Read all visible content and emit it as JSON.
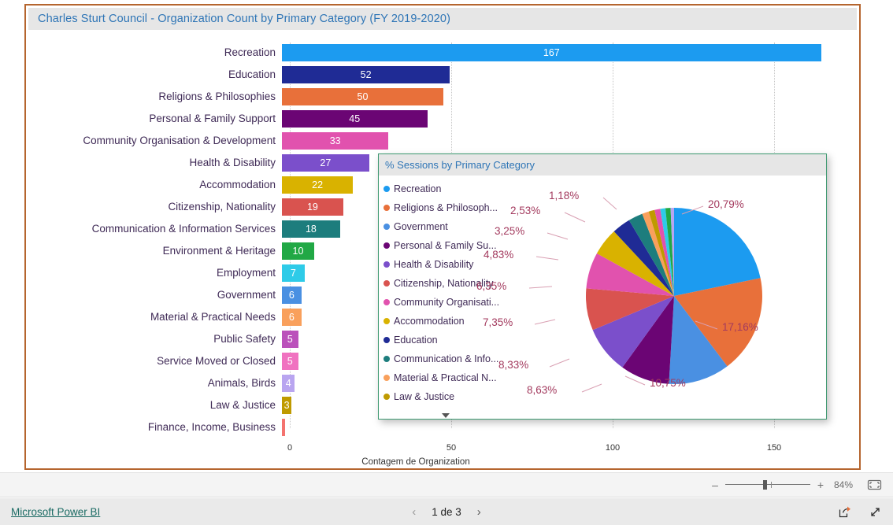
{
  "report": {
    "bar_visual_title": "Charles Sturt Council - Organization Count by Primary Category (FY 2019-2020)",
    "pie_visual_title": "% Sessions by Primary Category",
    "axis_title": "Contagem de Organization",
    "accent_border": "#b5652e",
    "title_color": "#2e75b6"
  },
  "chart_data": [
    {
      "type": "bar",
      "title": "Charles Sturt Council - Organization Count by Primary Category (FY 2019-2020)",
      "xlabel": "Contagem de Organization",
      "ylabel": "",
      "xlim": [
        0,
        175
      ],
      "grid": true,
      "orientation": "horizontal",
      "ticks": [
        0,
        50,
        100,
        150
      ],
      "categories": [
        "Recreation",
        "Education",
        "Religions & Philosophies",
        "Personal & Family Support",
        "Community Organisation & Development",
        "Health & Disability",
        "Accommodation",
        "Citizenship, Nationality",
        "Communication & Information Services",
        "Environment & Heritage",
        "Employment",
        "Government",
        "Material & Practical Needs",
        "Public Safety",
        "Service Moved or Closed",
        "Animals, Birds",
        "Law & Justice",
        "Finance, Income, Business"
      ],
      "values": [
        167,
        52,
        50,
        45,
        33,
        27,
        22,
        19,
        18,
        10,
        7,
        6,
        6,
        5,
        5,
        4,
        3,
        1
      ],
      "value_labels": [
        "167",
        "52",
        "50",
        "45",
        "33",
        "27",
        "22",
        "19",
        "18",
        "10",
        "7",
        "6",
        "6",
        "5",
        "5",
        "4",
        "3",
        ""
      ],
      "colors": [
        "#1c9bf0",
        "#1f2b95",
        "#e8703a",
        "#6b0574",
        "#e152ae",
        "#7b4fcb",
        "#d9b200",
        "#d9534f",
        "#1d7d7d",
        "#21a845",
        "#2ecbe8",
        "#4a90e2",
        "#f9a05c",
        "#bb51bb",
        "#f072c0",
        "#b9a5f0",
        "#bf9a00",
        "#f4736f"
      ]
    },
    {
      "type": "pie",
      "title": "% Sessions by Primary Category",
      "legend_position": "left",
      "labels": [
        "Recreation",
        "Religions & Philosoph...",
        "Government",
        "Personal & Family Su...",
        "Health & Disability",
        "Citizenship, Nationality",
        "Community Organisati...",
        "Accommodation",
        "Education",
        "Communication & Info...",
        "Material & Practical N...",
        "Law & Justice"
      ],
      "legend_colors": [
        "#1c9bf0",
        "#e8703a",
        "#4a90e2",
        "#6b0574",
        "#7b4fcb",
        "#d9534f",
        "#e152ae",
        "#d9b200",
        "#1f2b95",
        "#1d7d7d",
        "#f9a05c",
        "#bf9a00"
      ],
      "slice_colors": [
        "#1c9bf0",
        "#e8703a",
        "#4a90e2",
        "#6b0574",
        "#7b4fcb",
        "#d9534f",
        "#e152ae",
        "#d9b200",
        "#1f2b95",
        "#1d7d7d",
        "#f9a05c",
        "#bf9a00",
        "#e152ae",
        "#2ecbe8",
        "#21a845",
        "#b9a5f0"
      ],
      "values": [
        20.79,
        17.16,
        10.75,
        8.63,
        8.33,
        7.35,
        6.35,
        4.83,
        3.25,
        2.53,
        1.18,
        1.05,
        1.0,
        0.9,
        0.9,
        0.6
      ],
      "pct_labels": [
        "20,79%",
        "17,16%",
        "10,75%",
        "8,63%",
        "8,33%",
        "7,35%",
        "6,35%",
        "4,83%",
        "3,25%",
        "2,53%",
        "1,18%"
      ],
      "legend_more_icon": "chevron-down-icon"
    }
  ],
  "zoom_bar": {
    "minus": "–",
    "plus": "+",
    "level": "84%",
    "fit_icon": "fit-to-page-icon"
  },
  "footer": {
    "brand": "Microsoft Power BI",
    "prev_arrow": "‹",
    "next_arrow": "›",
    "page_label": "1 de 3",
    "share_icon": "share-icon",
    "fullscreen_icon": "fullscreen-icon"
  }
}
